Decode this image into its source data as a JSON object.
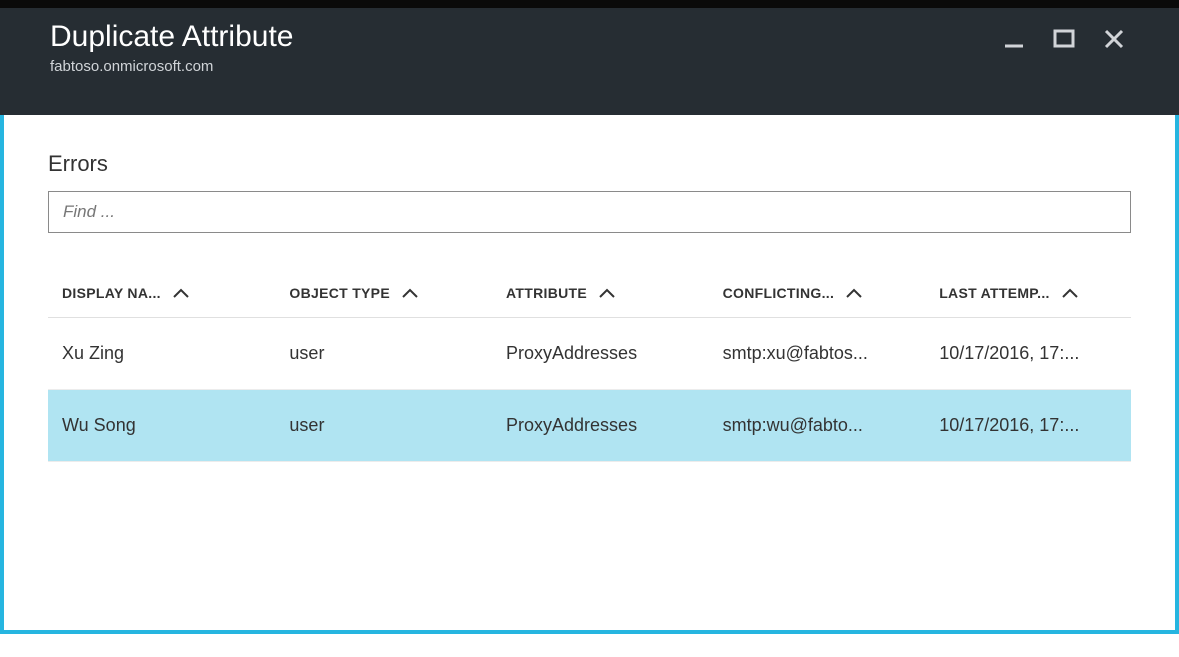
{
  "header": {
    "title": "Duplicate Attribute",
    "subtitle": "fabtoso.onmicrosoft.com"
  },
  "main": {
    "section_title": "Errors",
    "search_placeholder": "Find ..."
  },
  "table": {
    "columns": [
      {
        "label": "DISPLAY NA..."
      },
      {
        "label": "OBJECT TYPE"
      },
      {
        "label": "ATTRIBUTE"
      },
      {
        "label": "CONFLICTING..."
      },
      {
        "label": "LAST ATTEMP..."
      }
    ],
    "rows": [
      {
        "display_name": "Xu Zing",
        "object_type": "user",
        "attribute": "ProxyAddresses",
        "conflicting": "smtp:xu@fabtos...",
        "last_attempt": "10/17/2016, 17:...",
        "selected": false
      },
      {
        "display_name": "Wu Song",
        "object_type": "user",
        "attribute": "ProxyAddresses",
        "conflicting": "smtp:wu@fabto...",
        "last_attempt": "10/17/2016, 17:...",
        "selected": true
      }
    ]
  }
}
